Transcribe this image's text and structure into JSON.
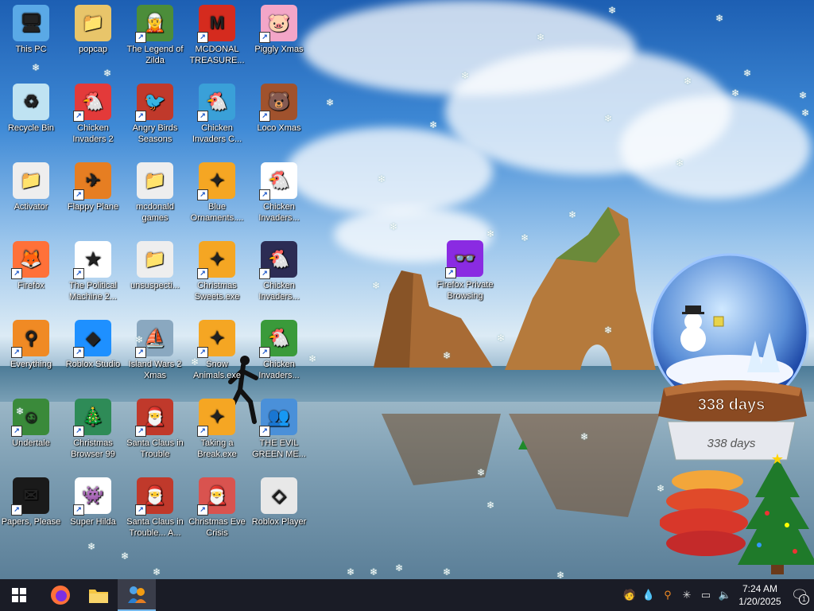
{
  "desktop": {
    "icons": [
      {
        "label": "This PC",
        "shortcut": false,
        "icon": "computer-icon",
        "color": "#5aa9e6"
      },
      {
        "label": "popcap",
        "shortcut": false,
        "icon": "folder-icon",
        "color": "#e8c56a"
      },
      {
        "label": "The Legend of Zilda",
        "shortcut": true,
        "icon": "zilda-icon",
        "color": "#4c8d3a"
      },
      {
        "label": "MCDONAL TREASURE...",
        "shortcut": true,
        "icon": "mcdonalds-icon",
        "color": "#d52b1e"
      },
      {
        "label": "Piggly Xmas",
        "shortcut": true,
        "icon": "pig-icon",
        "color": "#f3a6c8"
      },
      {
        "label": "Recycle Bin",
        "shortcut": false,
        "icon": "recycle-bin-icon",
        "color": "#bfe3f2"
      },
      {
        "label": "Chicken Invaders 2",
        "shortcut": true,
        "icon": "chicken-icon",
        "color": "#e33a3a"
      },
      {
        "label": "Angry Birds Seasons",
        "shortcut": true,
        "icon": "angry-birds-icon",
        "color": "#c0392b"
      },
      {
        "label": "Chicken Invaders C...",
        "shortcut": true,
        "icon": "chicken-icon",
        "color": "#3aa0d8"
      },
      {
        "label": "Loco Xmas",
        "shortcut": true,
        "icon": "bear-icon",
        "color": "#a0522d"
      },
      {
        "label": "Activator",
        "shortcut": false,
        "icon": "folder-icon",
        "color": "#eeeeee"
      },
      {
        "label": "Flappy Plane",
        "shortcut": true,
        "icon": "plane-icon",
        "color": "#e67e22"
      },
      {
        "label": "mcdonald games",
        "shortcut": false,
        "icon": "folder-icon",
        "color": "#eeeeee"
      },
      {
        "label": "Blue Ornaments....",
        "shortcut": true,
        "icon": "ornament-icon",
        "color": "#f5a623"
      },
      {
        "label": "Chicken Invaders...",
        "shortcut": true,
        "icon": "chicken-icon",
        "color": "#ffffff"
      },
      {
        "label": "Firefox",
        "shortcut": true,
        "icon": "firefox-icon",
        "color": "#ff7139"
      },
      {
        "label": "The Political Machine 2...",
        "shortcut": true,
        "icon": "political-icon",
        "color": "#ffffff"
      },
      {
        "label": "unsuspecti...",
        "shortcut": false,
        "icon": "folder-icon",
        "color": "#eeeeee"
      },
      {
        "label": "Christmas Sweets.exe",
        "shortcut": true,
        "icon": "ornament-icon",
        "color": "#f5a623"
      },
      {
        "label": "Chicken Invaders...",
        "shortcut": true,
        "icon": "chicken-icon",
        "color": "#2c2c54"
      },
      {
        "label": "Everything",
        "shortcut": true,
        "icon": "search-icon",
        "color": "#f08a24"
      },
      {
        "label": "Roblox Studio",
        "shortcut": true,
        "icon": "roblox-studio-icon",
        "color": "#1e90ff"
      },
      {
        "label": "Island Wars 2 Xmas",
        "shortcut": true,
        "icon": "island-icon",
        "color": "#8aa8c0"
      },
      {
        "label": "Snow Animals.exe",
        "shortcut": true,
        "icon": "ornament-icon",
        "color": "#f5a623"
      },
      {
        "label": "Chicken Invaders...",
        "shortcut": true,
        "icon": "chicken-icon",
        "color": "#3a9a3a"
      },
      {
        "label": "Undertale",
        "shortcut": true,
        "icon": "undertale-icon",
        "color": "#3a8a3a"
      },
      {
        "label": "Christmas Browser 99",
        "shortcut": true,
        "icon": "tree-icon",
        "color": "#2e8b57"
      },
      {
        "label": "Santa Claus in Trouble",
        "shortcut": true,
        "icon": "santa-icon",
        "color": "#c0392b"
      },
      {
        "label": "Taking a Break.exe",
        "shortcut": true,
        "icon": "ornament-icon",
        "color": "#f5a623"
      },
      {
        "label": "THE EVIL GREEN ME...",
        "shortcut": true,
        "icon": "people-icon",
        "color": "#4a90d9"
      },
      {
        "label": "Papers, Please",
        "shortcut": true,
        "icon": "papers-please-icon",
        "color": "#1a1a1a"
      },
      {
        "label": "Super Hilda",
        "shortcut": true,
        "icon": "hilda-icon",
        "color": "#ffffff"
      },
      {
        "label": "Santa Claus in Trouble... A...",
        "shortcut": true,
        "icon": "santa-icon",
        "color": "#c0392b"
      },
      {
        "label": "Christmas Eve Crisis",
        "shortcut": true,
        "icon": "santa-icon",
        "color": "#d9534f"
      },
      {
        "label": "Roblox Player",
        "shortcut": false,
        "icon": "roblox-icon",
        "color": "#e8e8e8"
      },
      {
        "label": "Firefox Private Browsing",
        "shortcut": true,
        "icon": "firefox-private-icon",
        "color": "#8a2be2"
      }
    ],
    "globe": {
      "countdown": "338 days",
      "countdown_base": "338 days"
    }
  },
  "taskbar": {
    "clock_time": "7:24 AM",
    "clock_date": "1/20/2025",
    "notification_count": "1",
    "pinned": [
      "start-button",
      "firefox",
      "file-explorer",
      "people-app"
    ]
  }
}
